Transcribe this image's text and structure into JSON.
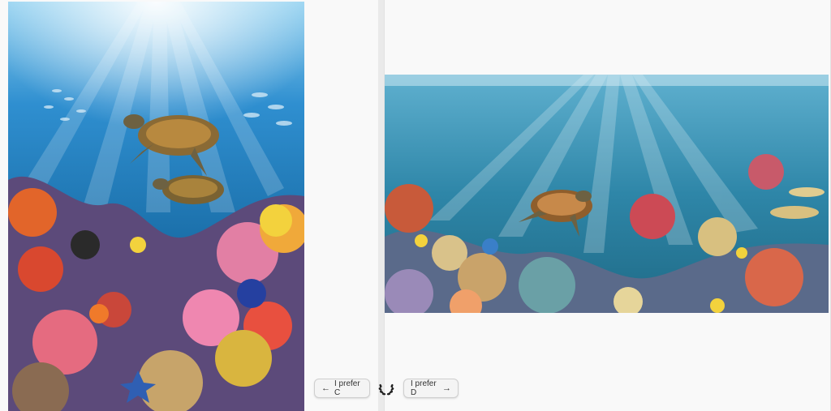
{
  "comparison": {
    "left_image": "coral reef with two sea turtles and tropical fish",
    "right_image": "wide coral reef with one sea turtle and sun rays"
  },
  "controls": {
    "prefer_c_label": "I prefer C",
    "prefer_d_label": "I prefer D",
    "left_arrow_icon": "arrow-left-icon",
    "right_arrow_icon": "arrow-right-icon",
    "tie_icon": "laurel-icon"
  },
  "colors": {
    "button_bg": "#f4f4f4",
    "button_border": "#cfcfcf",
    "page_bg": "#f8f8f8"
  }
}
